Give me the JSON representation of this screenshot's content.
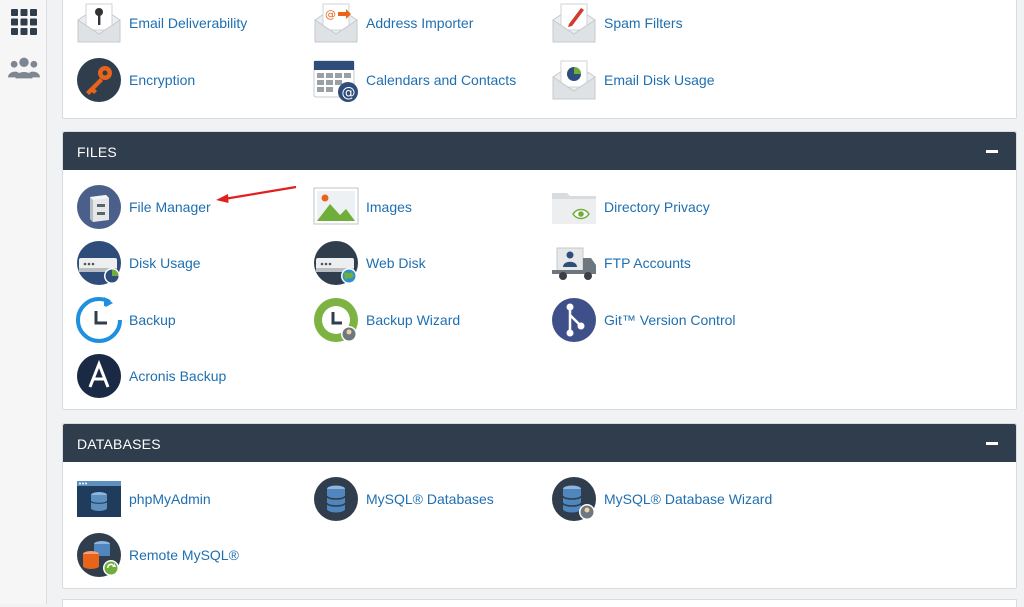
{
  "sidebar": {
    "items": [
      {
        "name": "apps-grid-icon"
      },
      {
        "name": "users-icon"
      }
    ]
  },
  "email": {
    "items": [
      {
        "label": "Email Deliverability",
        "icon": "envelope-key-icon"
      },
      {
        "label": "Address Importer",
        "icon": "envelope-at-icon"
      },
      {
        "label": "Spam Filters",
        "icon": "envelope-pen-icon"
      },
      {
        "label": "Encryption",
        "icon": "key-icon"
      },
      {
        "label": "Calendars and Contacts",
        "icon": "calendar-at-icon"
      },
      {
        "label": "Email Disk Usage",
        "icon": "envelope-pie-icon"
      }
    ]
  },
  "files": {
    "title": "FILES",
    "items": [
      {
        "label": "File Manager",
        "icon": "file-cabinet-icon"
      },
      {
        "label": "Images",
        "icon": "image-icon"
      },
      {
        "label": "Directory Privacy",
        "icon": "folder-eye-icon"
      },
      {
        "label": "Disk Usage",
        "icon": "disk-usage-icon"
      },
      {
        "label": "Web Disk",
        "icon": "web-disk-icon"
      },
      {
        "label": "FTP Accounts",
        "icon": "ftp-truck-icon"
      },
      {
        "label": "Backup",
        "icon": "backup-clock-icon"
      },
      {
        "label": "Backup Wizard",
        "icon": "backup-wizard-icon"
      },
      {
        "label": "Git™ Version Control",
        "icon": "git-icon"
      },
      {
        "label": "Acronis Backup",
        "icon": "acronis-icon"
      }
    ]
  },
  "databases": {
    "title": "DATABASES",
    "items": [
      {
        "label": "phpMyAdmin",
        "icon": "phpmyadmin-icon"
      },
      {
        "label": "MySQL® Databases",
        "icon": "mysql-database-icon"
      },
      {
        "label": "MySQL® Database Wizard",
        "icon": "mysql-wizard-icon"
      },
      {
        "label": "Remote MySQL®",
        "icon": "remote-mysql-icon"
      }
    ]
  },
  "colors": {
    "header_bg": "#2f3d4c",
    "link": "#1f6fb0",
    "annotation_arrow": "#e0201e"
  }
}
